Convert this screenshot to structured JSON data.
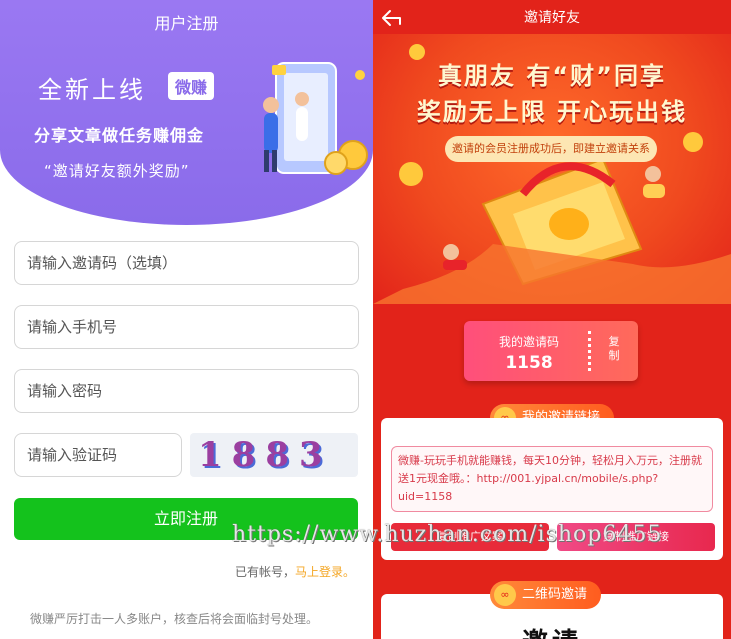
{
  "left": {
    "title": "用户注册",
    "banner": {
      "headline": "全新上线",
      "badge": "微赚",
      "line2": "分享文章做任务赚佣金",
      "line3": "“邀请好友额外奖励”"
    },
    "form": {
      "invite_placeholder": "请输入邀请码（选填）",
      "phone_placeholder": "请输入手机号",
      "password_placeholder": "请输入密码",
      "captcha_placeholder": "请输入验证码",
      "captcha_text": "1883"
    },
    "submit_label": "立即注册",
    "has_account": "已有帐号，",
    "login_link": "马上登录。",
    "notice": "微赚严厉打击一人多账户，核查后将会面临封号处理。"
  },
  "right": {
    "title": "邀请好友",
    "headline1": "真朋友 有“财”同享",
    "headline2": "奖励无上限 开心玩出钱",
    "pill": "邀请的会员注册成功后，即建立邀请关系",
    "my_code_label": "我的邀请码",
    "my_code_value": "1158",
    "copy_label": "复制",
    "link_section_title": "我的邀请链接",
    "link_text": "微赚-玩玩手机就能赚钱，每天10分钟，轻松月入万元，注册就送1元现金哦。：http://001.yjpal.cn/mobile/s.php?uid=1158",
    "copy_ad_label": "复制推广文案",
    "copy_link_label": "复制推广链接",
    "qr_section_title": "二维码邀请",
    "qr_big_text": "邀请"
  },
  "watermark": "https://www.huzhan.com/ishop6455",
  "colors": {
    "purple": "#8a6bea",
    "green": "#14c21c",
    "red": "#e2231a",
    "orange": "#ff6a2a",
    "gold": "#f4a623"
  }
}
